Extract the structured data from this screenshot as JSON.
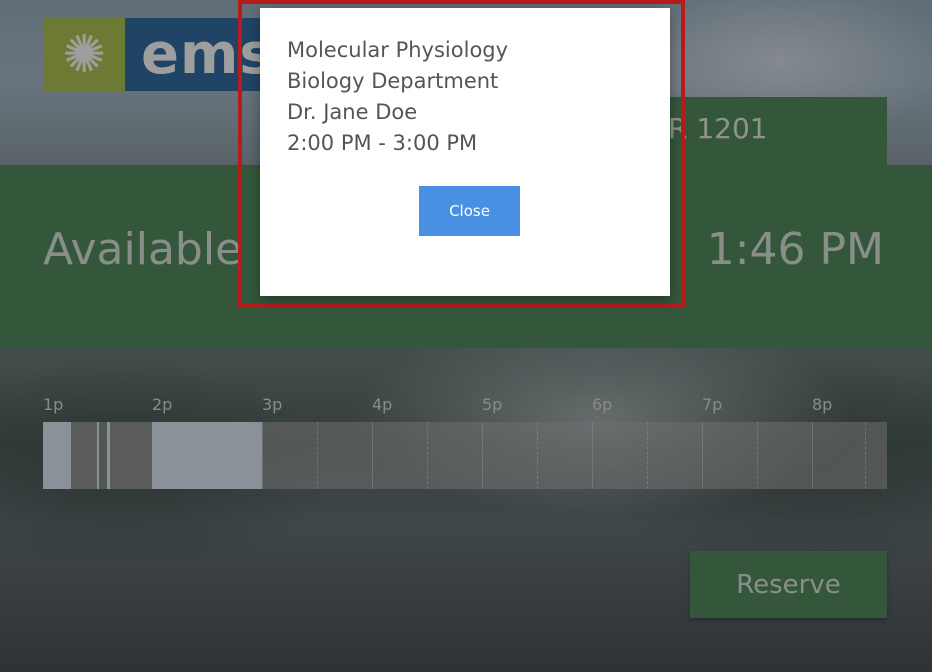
{
  "brand": {
    "logo_text": "ems",
    "logo_icon": "sun-icon",
    "colors": {
      "logo_mark": "#a7be3e",
      "logo_word": "#1b5c97"
    }
  },
  "room": {
    "label": "R 1201"
  },
  "status": {
    "label": "Available",
    "time": "1:46 PM",
    "color": "#3e7e4b"
  },
  "timeline": {
    "hour_labels": [
      "1p",
      "2p",
      "3p",
      "4p",
      "5p",
      "6p",
      "7p",
      "8p"
    ],
    "booked_color": "#dce8f5"
  },
  "actions": {
    "reserve_label": "Reserve"
  },
  "modal": {
    "lines": [
      "Molecular Physiology",
      "Biology Department",
      "Dr. Jane Doe",
      "2:00 PM - 3:00 PM"
    ],
    "close_label": "Close",
    "close_color": "#4a90e2"
  }
}
